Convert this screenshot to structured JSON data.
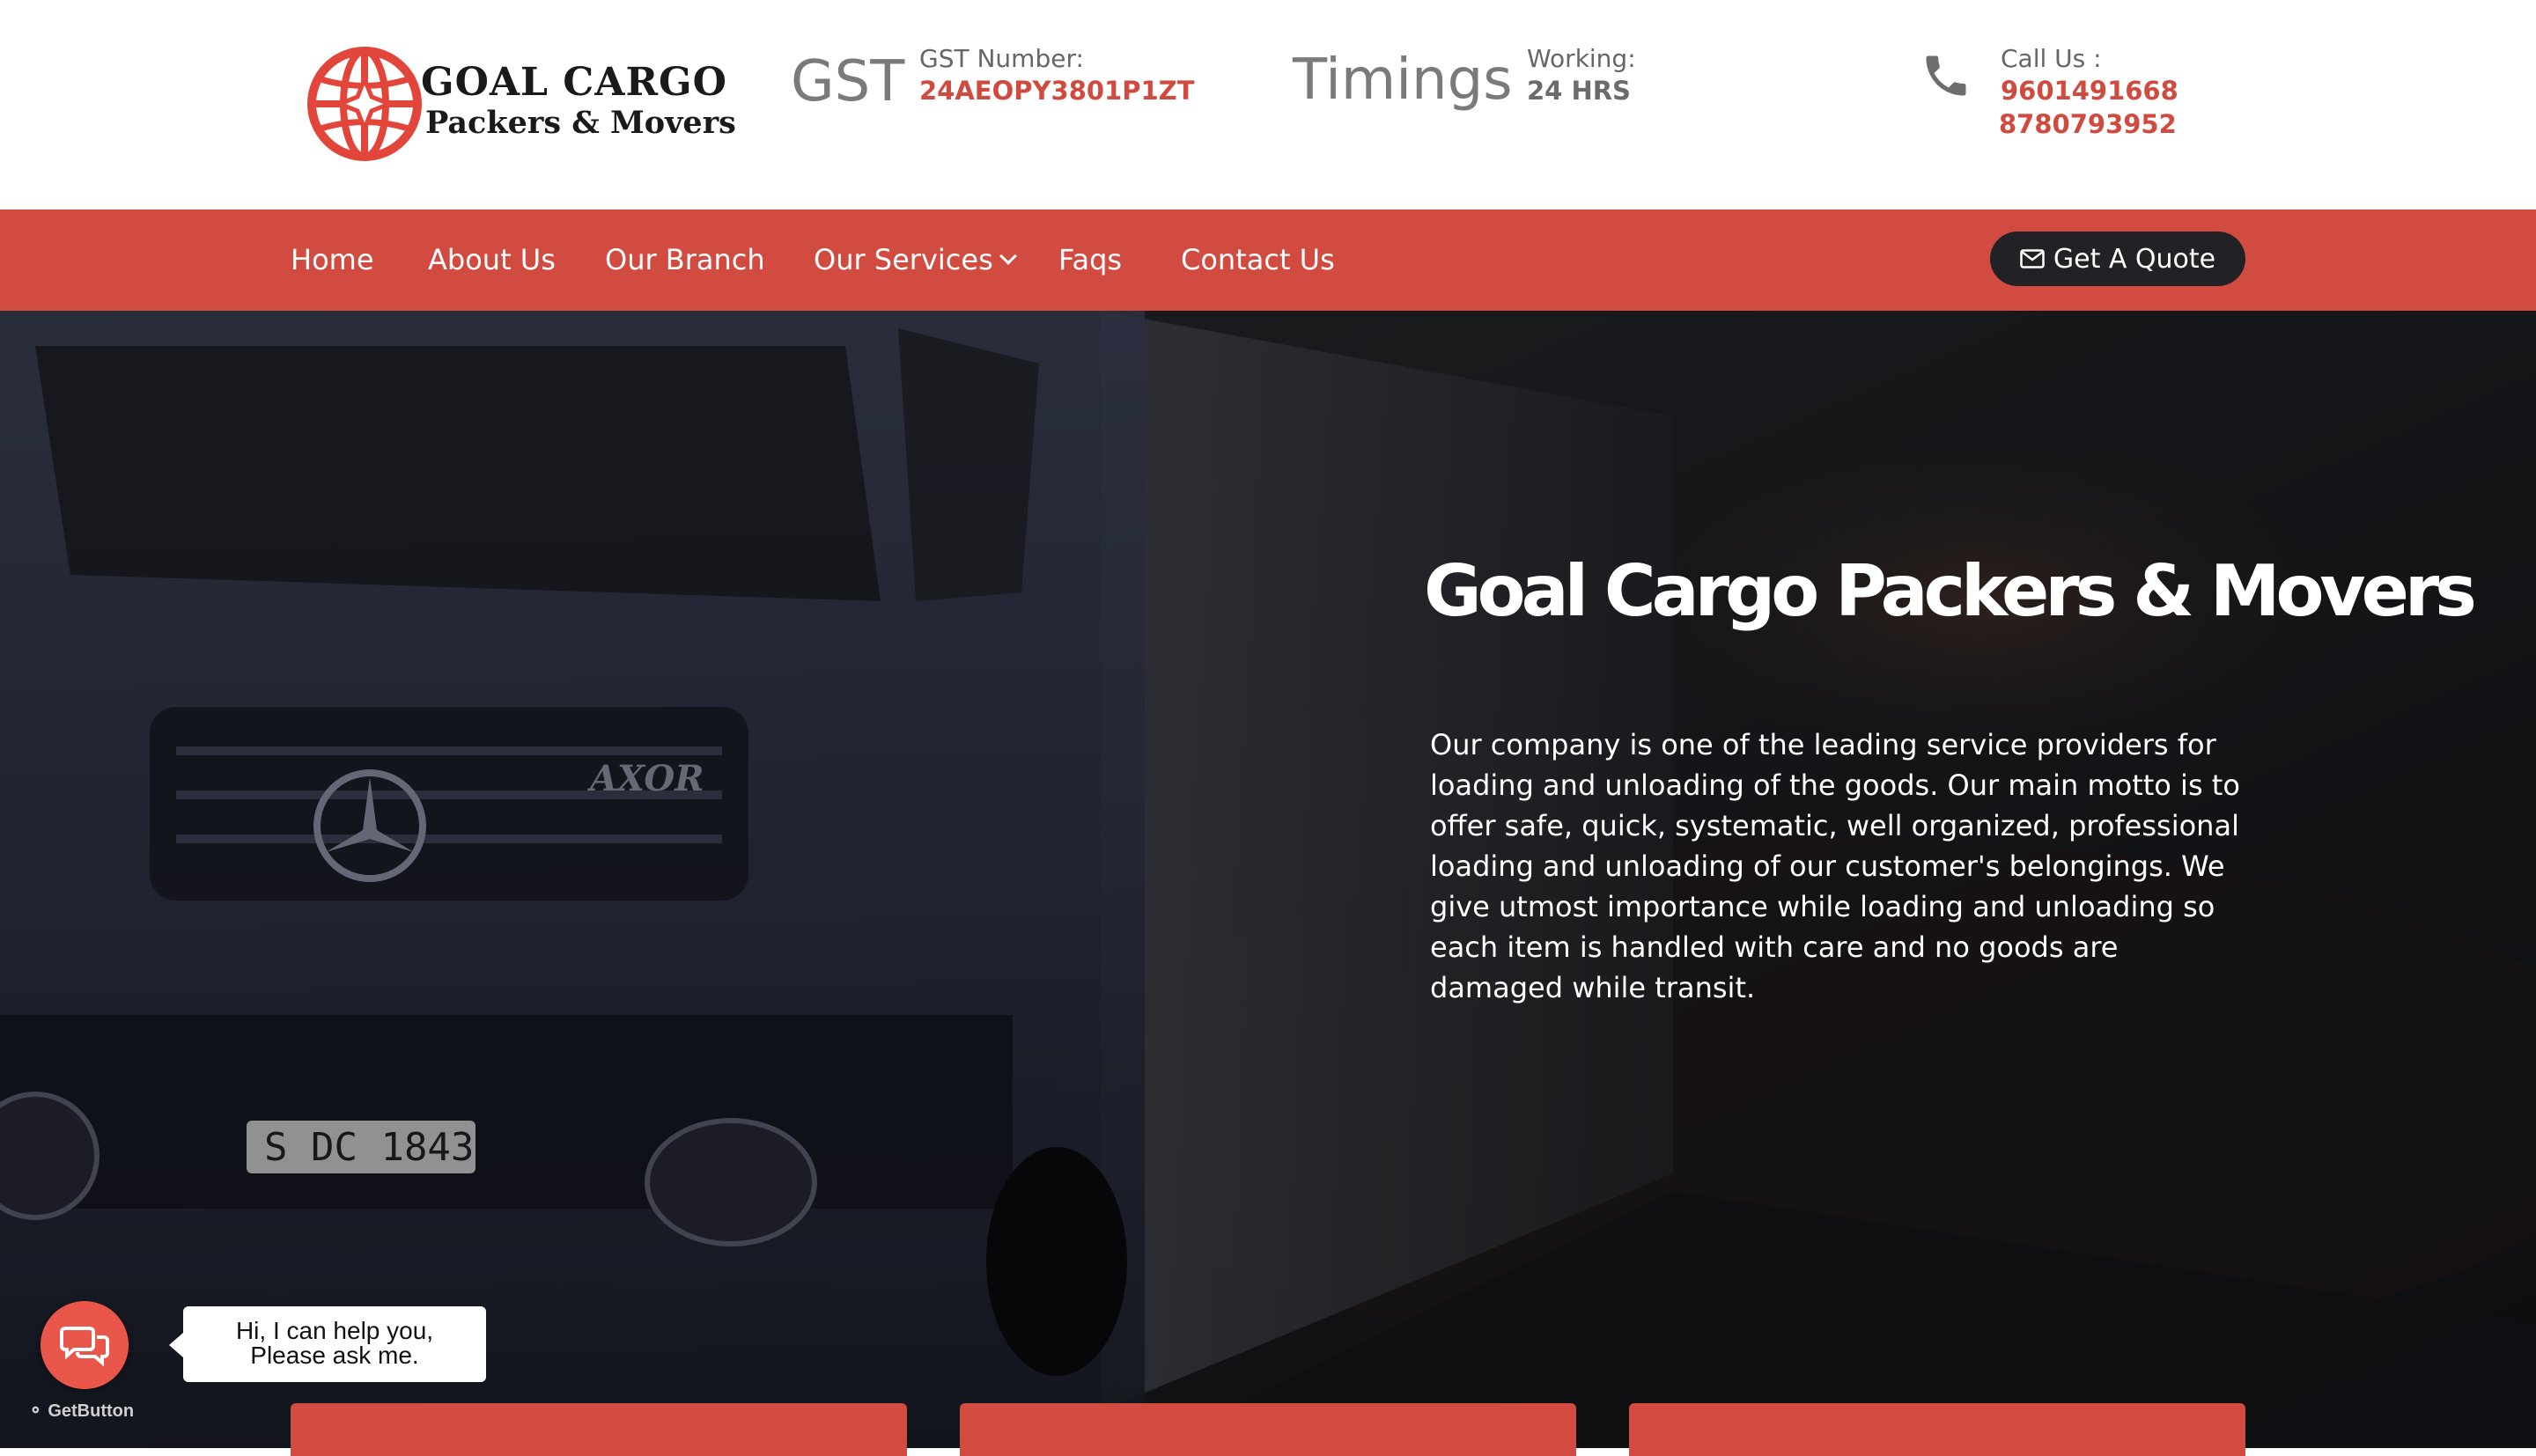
{
  "header": {
    "logo": {
      "line1": "GOAL CARGO",
      "line2": "Packers & Movers"
    },
    "gst": {
      "heading": "GST",
      "label": "GST Number:",
      "value": "24AEOPY3801P1ZT"
    },
    "timings": {
      "heading": "Timings",
      "label": "Working:",
      "value": "24 HRS"
    },
    "call": {
      "label": "Call Us :",
      "numbers": [
        "9601491668",
        "8780793952"
      ]
    }
  },
  "nav": {
    "items": [
      "Home",
      "About Us",
      "Our Branch",
      "Our Services",
      "Faqs",
      "Contact Us"
    ],
    "quote_button": "Get A Quote"
  },
  "hero": {
    "title": "Goal Cargo Packers & Movers",
    "description": "Our company is one of the leading service providers for loading and unloading of the goods. Our main motto is to offer safe, quick, systematic, well organized, professional loading and unloading of our customer's belongings. We give utmost importance while loading and unloading so each item is handled with care and no goods are damaged while transit.",
    "license_plate": "S DC 1843",
    "truck_badge": "AXOR"
  },
  "chat": {
    "message_line1": "Hi, I can help you,",
    "message_line2": "Please ask me.",
    "brand": "GetButton"
  },
  "colors": {
    "accent": "#d14b41",
    "dark_button": "#222226",
    "gray_text": "#7a7a7a"
  },
  "icons": [
    "globe-logo-icon",
    "phone-icon",
    "envelope-icon",
    "chevron-down-icon",
    "chat-icon"
  ]
}
